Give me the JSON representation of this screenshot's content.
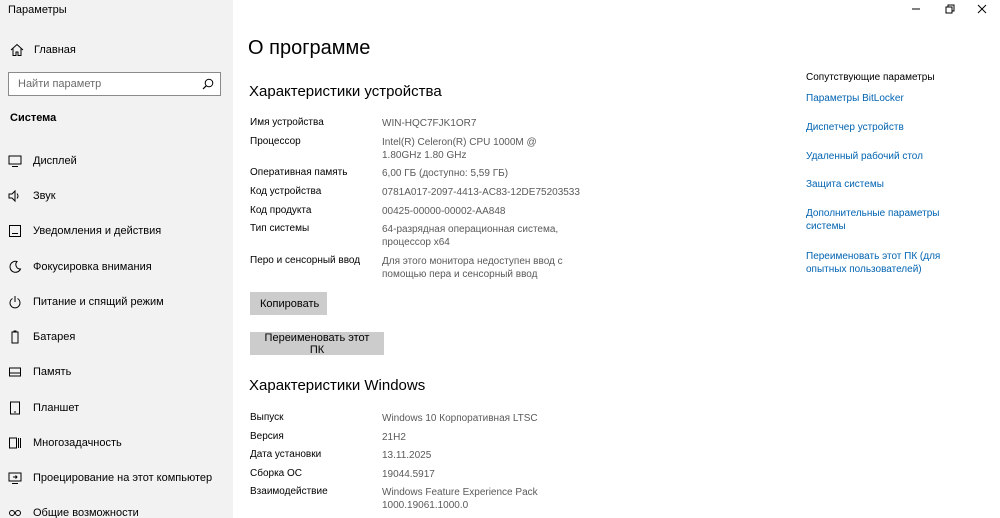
{
  "window": {
    "title": "Параметры"
  },
  "sidebar": {
    "home_label": "Главная",
    "search_placeholder": "Найти параметр",
    "section_title": "Система",
    "items": [
      {
        "label": "Дисплей",
        "icon": "display-icon"
      },
      {
        "label": "Звук",
        "icon": "sound-icon"
      },
      {
        "label": "Уведомления и действия",
        "icon": "notifications-icon"
      },
      {
        "label": "Фокусировка внимания",
        "icon": "focus-assist-icon"
      },
      {
        "label": "Питание и спящий режим",
        "icon": "power-icon"
      },
      {
        "label": "Батарея",
        "icon": "battery-icon"
      },
      {
        "label": "Память",
        "icon": "storage-icon"
      },
      {
        "label": "Планшет",
        "icon": "tablet-icon"
      },
      {
        "label": "Многозадачность",
        "icon": "multitasking-icon"
      },
      {
        "label": "Проецирование на этот компьютер",
        "icon": "projecting-icon"
      },
      {
        "label": "Общие возможности",
        "icon": "shared-experiences-icon"
      }
    ]
  },
  "main": {
    "title": "О программе",
    "device_specs": {
      "heading": "Характеристики устройства",
      "rows": [
        {
          "label": "Имя устройства",
          "value": "WIN-HQC7FJK1OR7"
        },
        {
          "label": "Процессор",
          "value": "Intel(R) Celeron(R) CPU 1000M @ 1.80GHz 1.80 GHz"
        },
        {
          "label": "Оперативная память",
          "value": "6,00 ГБ (доступно: 5,59 ГБ)"
        },
        {
          "label": "Код устройства",
          "value": "0781A017-2097-4413-AC83-12DE75203533"
        },
        {
          "label": "Код продукта",
          "value": "00425-00000-00002-AA848"
        },
        {
          "label": "Тип системы",
          "value": "64-разрядная операционная система, процессор x64"
        },
        {
          "label": "Перо и сенсорный ввод",
          "value": "Для этого монитора недоступен ввод с помощью пера и сенсорный ввод"
        }
      ],
      "copy_button": "Копировать",
      "rename_button": "Переименовать этот ПК"
    },
    "windows_specs": {
      "heading": "Характеристики Windows",
      "rows": [
        {
          "label": "Выпуск",
          "value": "Windows 10 Корпоративная LTSC"
        },
        {
          "label": "Версия",
          "value": "21H2"
        },
        {
          "label": "Дата установки",
          "value": "13.11.2025"
        },
        {
          "label": "Сборка ОС",
          "value": "19044.5917"
        },
        {
          "label": "Взаимодействие",
          "value": "Windows Feature Experience Pack 1000.19061.1000.0"
        }
      ]
    }
  },
  "related": {
    "title": "Сопутствующие параметры",
    "links": [
      "Параметры BitLocker",
      "Диспетчер устройств",
      "Удаленный рабочий стол",
      "Защита системы",
      "Дополнительные параметры системы",
      "Переименовать этот ПК (для опытных пользователей)"
    ]
  },
  "colors": {
    "sidebar_bg": "#f2f2f2",
    "link": "#0063b1",
    "button_bg": "#cccccc"
  }
}
